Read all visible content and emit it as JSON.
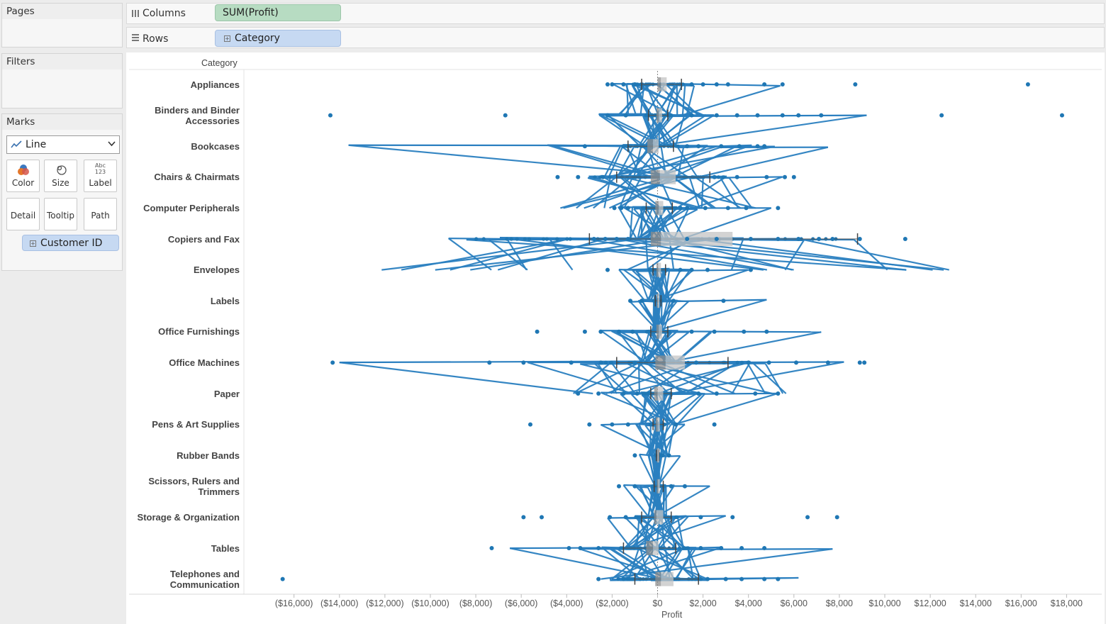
{
  "panels": {
    "pages_title": "Pages",
    "filters_title": "Filters",
    "marks_title": "Marks",
    "mark_type": "Line",
    "mark_buttons": [
      {
        "label": "Color",
        "icon": "color-icon"
      },
      {
        "label": "Size",
        "icon": "size-icon"
      },
      {
        "label": "Label",
        "icon": "label-icon"
      },
      {
        "label": "Detail",
        "icon": "detail-icon"
      },
      {
        "label": "Tooltip",
        "icon": "tooltip-icon"
      },
      {
        "label": "Path",
        "icon": "path-icon"
      }
    ],
    "detail_pill": "Customer ID",
    "label_icon_text": "Abc 123"
  },
  "shelves": {
    "columns_label": "Columns",
    "columns_pill": "SUM(Profit)",
    "rows_label": "Rows",
    "rows_pill": "Category"
  },
  "colors": {
    "mark": "#1f77b4",
    "line": "#2a7fc0",
    "box": "#a8a8a8",
    "columns_pill": "#b7dcc2",
    "rows_pill": "#c6d9f2"
  },
  "chart_data": {
    "type": "line",
    "subtype": "box-plot-with-line-marks",
    "column_header": "Category",
    "xlabel": "Profit",
    "xlim": [
      -17500,
      19000
    ],
    "x_ticks": [
      -16000,
      -14000,
      -12000,
      -10000,
      -8000,
      -6000,
      -4000,
      -2000,
      0,
      2000,
      4000,
      6000,
      8000,
      10000,
      12000,
      14000,
      16000,
      18000
    ],
    "x_tick_labels": [
      "($16,000)",
      "($14,000)",
      "($12,000)",
      "($10,000)",
      "($8,000)",
      "($6,000)",
      "($4,000)",
      "($2,000)",
      "$0",
      "$2,000",
      "$4,000",
      "$6,000",
      "$8,000",
      "$10,000",
      "$12,000",
      "$14,000",
      "$16,000",
      "$18,000"
    ],
    "reference_line": 0,
    "categories": [
      "Appliances",
      "Binders and Binder Accessories",
      "Bookcases",
      "Chairs & Chairmats",
      "Computer Peripherals",
      "Copiers and Fax",
      "Envelopes",
      "Labels",
      "Office Furnishings",
      "Office Machines",
      "Paper",
      "Pens & Art Supplies",
      "Rubber Bands",
      "Scissors, Rulers and Trimmers",
      "Storage & Organization",
      "Tables",
      "Telephones and Communication"
    ],
    "category_labels": [
      [
        "Appliances"
      ],
      [
        "Binders and Binder",
        "Accessories"
      ],
      [
        "Bookcases"
      ],
      [
        "Chairs & Chairmats"
      ],
      [
        "Computer Peripherals"
      ],
      [
        "Copiers and Fax"
      ],
      [
        "Envelopes"
      ],
      [
        "Labels"
      ],
      [
        "Office Furnishings"
      ],
      [
        "Office Machines"
      ],
      [
        "Paper"
      ],
      [
        "Pens & Art Supplies"
      ],
      [
        "Rubber Bands"
      ],
      [
        "Scissors, Rulers and",
        "Trimmers"
      ],
      [
        "Storage & Organization"
      ],
      [
        "Tables"
      ],
      [
        "Telephones and",
        "Communication"
      ]
    ],
    "box_stats": [
      {
        "whisker_low": -700,
        "q1": 0,
        "median": 150,
        "q3": 400,
        "whisker_high": 1050
      },
      {
        "whisker_low": -400,
        "q1": -50,
        "median": 50,
        "q3": 200,
        "whisker_high": 450
      },
      {
        "whisker_low": -1300,
        "q1": -450,
        "median": -200,
        "q3": 50,
        "whisker_high": 700
      },
      {
        "whisker_low": -1800,
        "q1": -300,
        "median": 100,
        "q3": 800,
        "whisker_high": 2300
      },
      {
        "whisker_low": -500,
        "q1": -100,
        "median": 50,
        "q3": 250,
        "whisker_high": 650
      },
      {
        "whisker_low": -3000,
        "q1": -300,
        "median": 150,
        "q3": 3300,
        "whisker_high": 8800
      },
      {
        "whisker_low": -200,
        "q1": -50,
        "median": 30,
        "q3": 150,
        "whisker_high": 350
      },
      {
        "whisker_low": -100,
        "q1": -30,
        "median": 10,
        "q3": 80,
        "whisker_high": 150
      },
      {
        "whisker_low": -300,
        "q1": -50,
        "median": 50,
        "q3": 200,
        "whisker_high": 450
      },
      {
        "whisker_low": -1800,
        "q1": -100,
        "median": 350,
        "q3": 1200,
        "whisker_high": 3100
      },
      {
        "whisker_low": -300,
        "q1": -150,
        "median": 0,
        "q3": 250,
        "whisker_high": 600
      },
      {
        "whisker_low": -200,
        "q1": -80,
        "median": 0,
        "q3": 100,
        "whisker_high": 250
      },
      {
        "whisker_low": -50,
        "q1": -20,
        "median": 0,
        "q3": 30,
        "whisker_high": 60
      },
      {
        "whisker_low": -150,
        "q1": -30,
        "median": 20,
        "q3": 100,
        "whisker_high": 250
      },
      {
        "whisker_low": -700,
        "q1": -150,
        "median": -50,
        "q3": 250,
        "whisker_high": 600
      },
      {
        "whisker_low": -1500,
        "q1": -500,
        "median": -200,
        "q3": 50,
        "whisker_high": 800
      },
      {
        "whisker_low": -1000,
        "q1": -100,
        "median": 150,
        "q3": 700,
        "whisker_high": 1800
      }
    ],
    "outliers": [
      [
        -2200,
        -2000,
        -1500,
        -1000,
        1500,
        2000,
        2600,
        3100,
        4700,
        5500,
        8700,
        16300
      ],
      [
        -14400,
        -6700,
        -2200,
        -1400,
        1500,
        2600,
        3500,
        4400,
        5500,
        6200,
        7200,
        12500,
        17800
      ],
      [
        -3200,
        -1500,
        1300,
        1800,
        2800,
        3600,
        4400,
        4700
      ],
      [
        -4400,
        -3500,
        -2400,
        2500,
        3500,
        4800,
        5600,
        6000
      ],
      [
        -1900,
        -1600,
        -1300,
        1000,
        1300,
        2100,
        3100,
        3900,
        5300
      ],
      [
        -2800,
        -2300,
        -1800,
        -1300,
        1300,
        2600,
        4100,
        5300,
        6200,
        7100,
        7700,
        8900,
        10900
      ],
      [
        -2200,
        1000,
        1500,
        2200,
        4100
      ],
      [
        -1200,
        -700,
        700,
        2900
      ],
      [
        -5300,
        -3200,
        -2500,
        -1700,
        -1100,
        1500,
        2500,
        3800,
        4800
      ],
      [
        -14300,
        -7400,
        -5900,
        -3800,
        -2500,
        -1000,
        1700,
        4000,
        4900,
        6100,
        7500,
        8900,
        9100
      ],
      [
        -3500,
        -2600,
        -1500,
        -900,
        1800,
        2600,
        4300,
        5300
      ],
      [
        -5600,
        -3000,
        -2000,
        -1300,
        800,
        2500
      ],
      [
        -1000,
        200,
        500
      ],
      [
        -1700,
        -1000,
        600,
        1200
      ],
      [
        -5900,
        -5100,
        -2100,
        -1400,
        1900,
        3300,
        6600,
        7900
      ],
      [
        -7300,
        -3900,
        -3400,
        -2600,
        1900,
        2800,
        3700,
        4700
      ],
      [
        -16500,
        -2600,
        -1500,
        2200,
        3000,
        3700,
        4700,
        5300
      ]
    ],
    "line_extremes": [
      {
        "min": -2000,
        "max": 5400
      },
      {
        "min": -2300,
        "max": 9200
      },
      {
        "min": -13600,
        "max": 7500
      },
      {
        "min": -2500,
        "max": 5500
      },
      {
        "min": -1500,
        "max": 5000
      },
      {
        "min": -9200,
        "max": 6200
      },
      {
        "min": -1700,
        "max": 4000
      },
      {
        "min": -1200,
        "max": 4800
      },
      {
        "min": -2500,
        "max": 7200
      },
      {
        "min": -14000,
        "max": 8200
      },
      {
        "min": -2500,
        "max": 5300
      },
      {
        "min": -2500,
        "max": 1200
      },
      {
        "min": -800,
        "max": 1000
      },
      {
        "min": -1500,
        "max": 2300
      },
      {
        "min": -2200,
        "max": 3000
      },
      {
        "min": -6500,
        "max": 7700
      },
      {
        "min": -2000,
        "max": 6200
      }
    ]
  }
}
